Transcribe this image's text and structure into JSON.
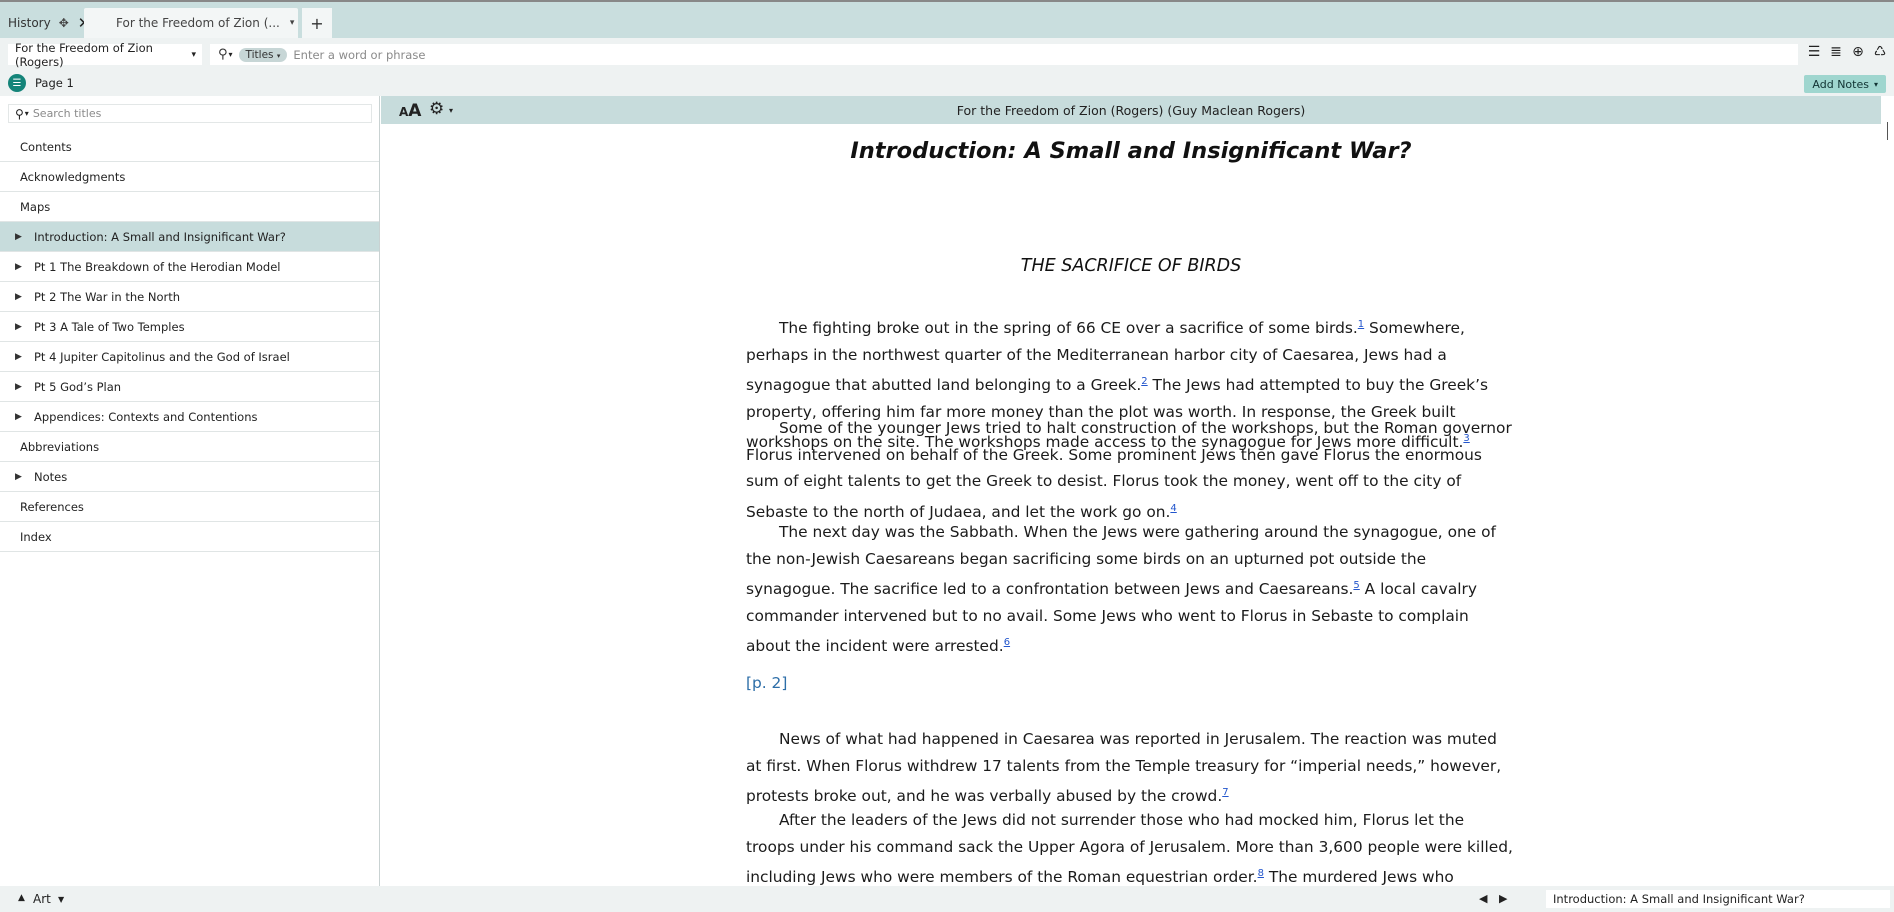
{
  "tabs": {
    "history_label": "History",
    "book_label": "For the Freedom of Zion (...",
    "new_tab": "+"
  },
  "toolbar": {
    "resource": "For the Freedom of Zion (Rogers)",
    "search_scope": "Titles",
    "search_placeholder": "Enter a word or phrase"
  },
  "pagerow": {
    "page": "Page 1",
    "add_notes": "Add Notes"
  },
  "sidebar": {
    "search_placeholder": "Search titles",
    "items": [
      {
        "label": "Contents",
        "expandable": false,
        "active": false
      },
      {
        "label": "Acknowledgments",
        "expandable": false,
        "active": false
      },
      {
        "label": "Maps",
        "expandable": false,
        "active": false
      },
      {
        "label": "Introduction: A Small and Insignificant War?",
        "expandable": true,
        "active": true
      },
      {
        "label": "Pt 1 The Breakdown of the Herodian Model",
        "expandable": true,
        "active": false
      },
      {
        "label": "Pt 2 The War in the North",
        "expandable": true,
        "active": false
      },
      {
        "label": "Pt 3 A Tale of Two Temples",
        "expandable": true,
        "active": false
      },
      {
        "label": "Pt 4 Jupiter Capitolinus and the God of Israel",
        "expandable": true,
        "active": false
      },
      {
        "label": "Pt 5 God’s Plan",
        "expandable": true,
        "active": false
      },
      {
        "label": "Appendices: Contexts and Contentions",
        "expandable": true,
        "active": false
      },
      {
        "label": "Abbreviations",
        "expandable": false,
        "active": false
      },
      {
        "label": "Notes",
        "expandable": true,
        "active": false
      },
      {
        "label": "References",
        "expandable": false,
        "active": false
      },
      {
        "label": "Index",
        "expandable": false,
        "active": false
      }
    ]
  },
  "reader": {
    "header_title": "For the Freedom of Zion (Rogers) (Guy Maclean Rogers)",
    "font_size_small": "A",
    "font_size_large": "A",
    "chapter_title": "Introduction: A Small and Insignificant War?",
    "section_title": "THE SACRIFICE OF BIRDS",
    "page_marker": "[p. 2]",
    "paragraphs": [
      {
        "segments": [
          {
            "t": "The fighting broke out in the spring of 66 CE over a sacrifice of some birds."
          },
          {
            "n": "1"
          },
          {
            "t": " Somewhere, perhaps in the northwest quarter of the Mediterranean harbor city of Caesarea, Jews had a synagogue that abutted land belonging to a Greek."
          },
          {
            "n": "2"
          },
          {
            "t": " The Jews had attempted to buy the Greek’s property, offering him far more money than the plot was worth. In response, the Greek built workshops on the site. The workshops made access to the synagogue for Jews more difficult."
          },
          {
            "n": "3"
          }
        ]
      },
      {
        "segments": [
          {
            "t": "Some of the younger Jews tried to halt construction of the workshops, but the Roman governor Florus intervened on behalf of the Greek. Some prominent Jews then gave Florus the enormous sum of eight talents to get the Greek to desist. Florus took the money, went off to the city of Sebaste to the north of Judaea, and let the work go on."
          },
          {
            "n": "4"
          }
        ]
      },
      {
        "segments": [
          {
            "t": "The next day was the Sabbath. When the Jews were gathering around the synagogue, one of the non-Jewish Caesareans began sacrificing some birds on an upturned pot outside the synagogue. The sacrifice led to a confrontation between Jews and Caesareans."
          },
          {
            "n": "5"
          },
          {
            "t": " A local cavalry commander intervened but to no avail. Some Jews who went to Florus in Sebaste to complain about the incident were arrested."
          },
          {
            "n": "6"
          }
        ]
      },
      {
        "segments": [
          {
            "t": "News of what had happened in Caesarea was reported in Jerusalem. The reaction was muted at first. When Florus withdrew 17 talents from the Temple treasury for “imperial needs,” however, protests broke out, and he was verbally abused by the crowd."
          },
          {
            "n": "7"
          }
        ]
      },
      {
        "segments": [
          {
            "t": "After the leaders of the Jews did not surrender those who had mocked him, Florus let the troops under his command sack the Upper Agora of Jerusalem. More than 3,600 people were killed, including Jews who were members of the Roman equestrian order."
          },
          {
            "n": "8"
          },
          {
            "t": " The murdered Jews who belonged to that order were"
          }
        ]
      }
    ]
  },
  "statusbar": {
    "layout": "Art",
    "location": "Introduction: A Small and Insignificant War?"
  },
  "colors": {
    "accent": "#148479",
    "header_bg": "#c7dcdc",
    "link": "#2255cc"
  }
}
